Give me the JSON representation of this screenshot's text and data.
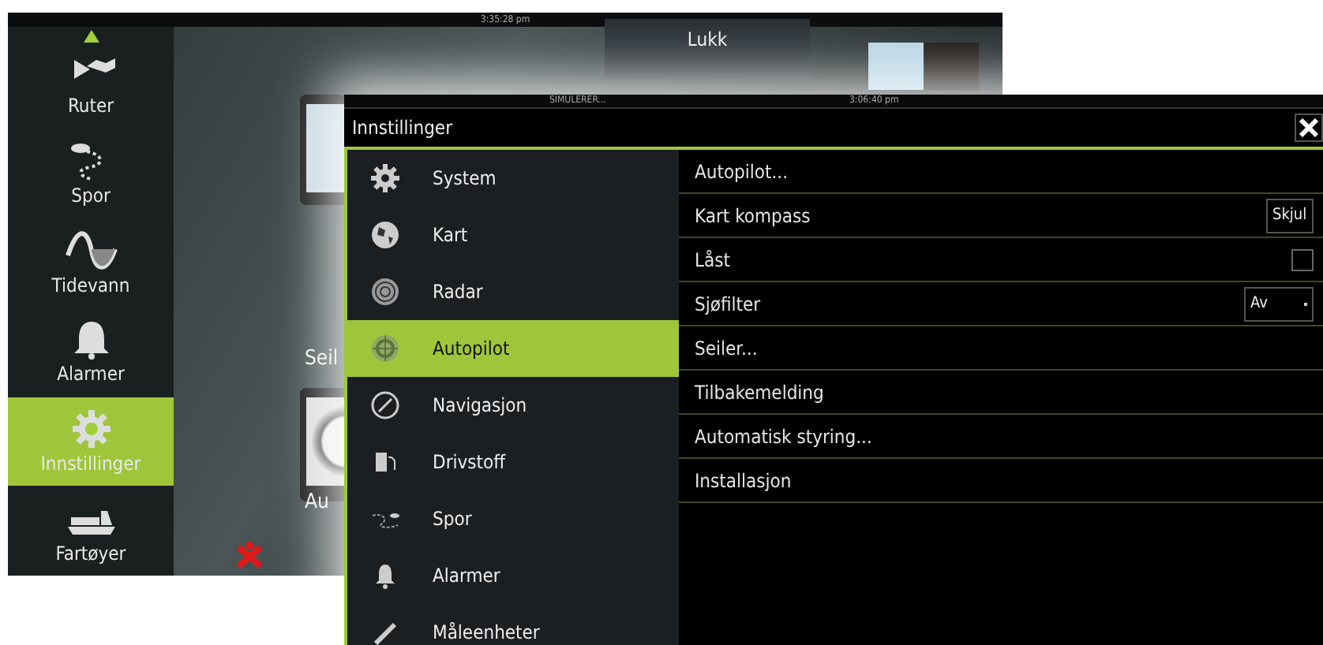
{
  "back_screen": {
    "time": "3:35:28 pm",
    "sidebar": [
      {
        "label": "Ruter",
        "selected": false
      },
      {
        "label": "Spor",
        "selected": false
      },
      {
        "label": "Tidevann",
        "selected": false
      },
      {
        "label": "Alarmer",
        "selected": false
      },
      {
        "label": "Innstillinger",
        "selected": true
      },
      {
        "label": "Fartøyer",
        "selected": false
      }
    ],
    "tiles": [
      {
        "label": "Seil"
      },
      {
        "label": "Au"
      }
    ],
    "close_button": "Lukk"
  },
  "settings_window": {
    "status": "SIMULERER...",
    "time": "3:06:40 pm",
    "title": "Innstillinger",
    "categories": [
      {
        "label": "System",
        "selected": false
      },
      {
        "label": "Kart",
        "selected": false
      },
      {
        "label": "Radar",
        "selected": false
      },
      {
        "label": "Autopilot",
        "selected": true
      },
      {
        "label": "Navigasjon",
        "selected": false
      },
      {
        "label": "Drivstoff",
        "selected": false
      },
      {
        "label": "Spor",
        "selected": false
      },
      {
        "label": "Alarmer",
        "selected": false
      },
      {
        "label": "Måleenheter",
        "selected": false
      }
    ],
    "options": [
      {
        "kind": "action",
        "label": "Autopilot..."
      },
      {
        "kind": "dropdown",
        "label": "Kart kompass",
        "value": "Skjul"
      },
      {
        "kind": "checkbox",
        "label": "Låst",
        "checked": false
      },
      {
        "kind": "dropdown",
        "label": "Sjøfilter",
        "value": "Av"
      },
      {
        "kind": "action",
        "label": "Seiler..."
      },
      {
        "kind": "action",
        "label": "Tilbakemelding"
      },
      {
        "kind": "action",
        "label": "Automatisk styring..."
      },
      {
        "kind": "action",
        "label": "Installasjon"
      }
    ]
  }
}
